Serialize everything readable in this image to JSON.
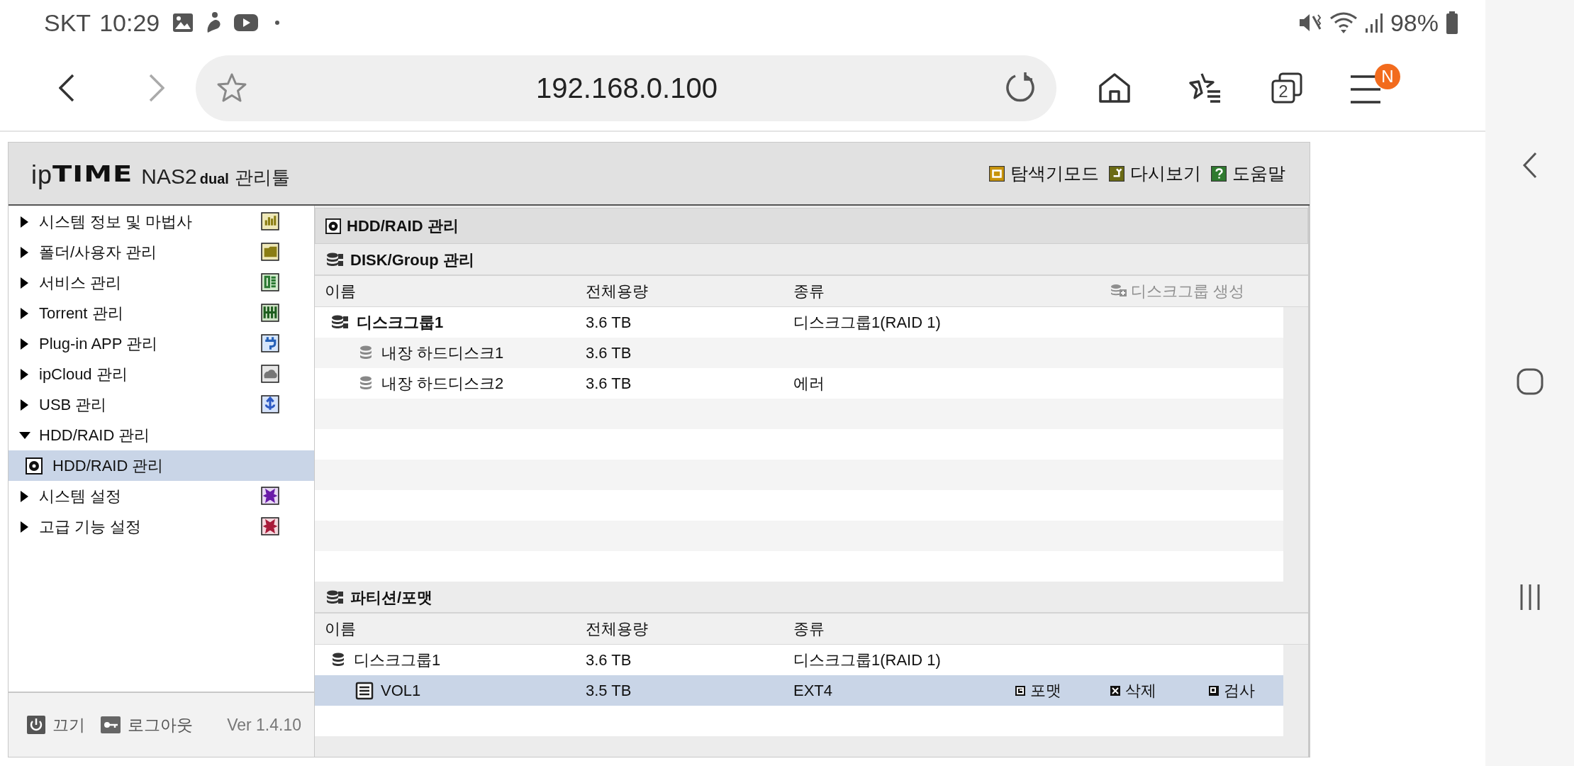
{
  "status_bar": {
    "carrier": "SKT",
    "time": "10:29",
    "battery": "98%"
  },
  "browser": {
    "url": "192.168.0.100",
    "tab_count": "2",
    "menu_badge": "N"
  },
  "app": {
    "logo": {
      "prefix": "ip",
      "brand": "TIME",
      "model": "NAS2",
      "model_suffix": "dual",
      "tool": "관리툴"
    },
    "header_links": [
      {
        "label": "탐색기모드",
        "kind": "explorer"
      },
      {
        "label": "다시보기",
        "kind": "refresh"
      },
      {
        "label": "도움말",
        "kind": "help"
      }
    ],
    "sidebar": {
      "items": [
        {
          "label": "시스템 정보 및 마법사",
          "expanded": false,
          "kind": "chart"
        },
        {
          "label": "폴더/사용자 관리",
          "expanded": false,
          "kind": "folder"
        },
        {
          "label": "서비스 관리",
          "expanded": false,
          "kind": "service"
        },
        {
          "label": "Torrent 관리",
          "expanded": false,
          "kind": "torrent"
        },
        {
          "label": "Plug-in APP 관리",
          "expanded": false,
          "kind": "plugin"
        },
        {
          "label": "ipCloud 관리",
          "expanded": false,
          "kind": "cloud"
        },
        {
          "label": "USB 관리",
          "expanded": false,
          "kind": "usb"
        },
        {
          "label": "HDD/RAID 관리",
          "expanded": true,
          "kind": "none",
          "children": [
            {
              "label": "HDD/RAID 관리",
              "selected": true
            }
          ]
        },
        {
          "label": "시스템 설정",
          "expanded": false,
          "kind": "settings"
        },
        {
          "label": "고급 기능 설정",
          "expanded": false,
          "kind": "advanced"
        }
      ],
      "footer": {
        "power": "끄기",
        "logout": "로그아웃",
        "version": "Ver 1.4.10"
      }
    },
    "main": {
      "title": "HDD/RAID 관리",
      "disk_group": {
        "title": "DISK/Group 관리",
        "columns": [
          "이름",
          "전체용량",
          "종류"
        ],
        "create_button": {
          "label": "디스크그룹 생성",
          "disabled": true
        },
        "rows": [
          {
            "name": "디스크그룹1",
            "capacity": "3.6 TB",
            "type": "디스크그룹1(RAID 1)",
            "emphasized": true,
            "children": [
              {
                "name": "내장 하드디스크1",
                "capacity": "3.6 TB"
              },
              {
                "name": "내장 하드디스크2",
                "capacity": "3.6 TB",
                "type": "에러"
              }
            ]
          }
        ]
      },
      "partition": {
        "title": "파티션/포맷",
        "columns": [
          "이름",
          "전체용량",
          "종류"
        ],
        "rows": [
          {
            "name": "디스크그룹1",
            "capacity": "3.6 TB",
            "type": "디스크그룹1(RAID 1)",
            "emphasized": false,
            "selected": false,
            "children": [
              {
                "name": "VOL1",
                "capacity": "3.5 TB",
                "type": "EXT4",
                "selected": true,
                "actions": [
                  {
                    "label": "포맷",
                    "kind": "format"
                  },
                  {
                    "label": "삭제",
                    "kind": "delete"
                  },
                  {
                    "label": "검사",
                    "kind": "check"
                  }
                ]
              }
            ]
          }
        ]
      }
    }
  }
}
